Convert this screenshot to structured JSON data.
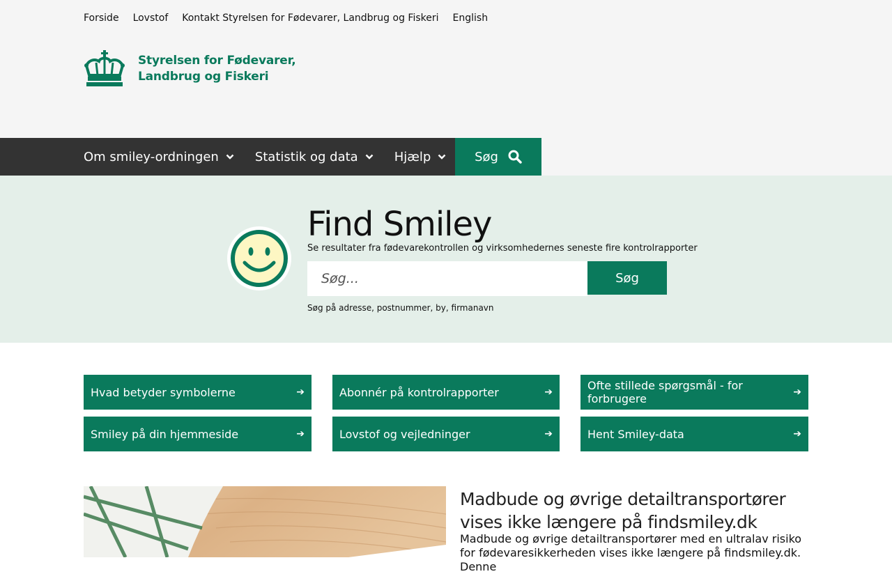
{
  "topnav": [
    "Forside",
    "Lovstof",
    "Kontakt Styrelsen for Fødevarer, Landbrug og Fiskeri",
    "English"
  ],
  "logo": {
    "line1": "Styrelsen for Fødevarer,",
    "line2": "Landbrug og Fiskeri"
  },
  "mainnav": {
    "items": [
      "Om smiley-ordningen",
      "Statistik og data",
      "Hjælp"
    ],
    "search_label": "Søg"
  },
  "hero": {
    "title": "Find Smiley",
    "subtitle": "Se resultater fra fødevarekontrollen og virksomhedernes seneste fire kontrolrapporter",
    "search_placeholder": "Søg...",
    "search_button": "Søg",
    "hint": "Søg på adresse, postnummer, by, firmanavn"
  },
  "quicklinks": [
    "Hvad betyder symbolerne",
    "Abonnér på kontrolrapporter",
    "Ofte stillede spørgsmål - for forbrugere",
    "Smiley på din hjemmeside",
    "Lovstof og vejledninger",
    "Hent Smiley-data"
  ],
  "news": {
    "title": "Madbude og øvrige detailtransportører vises ikke længere på findsmiley.dk",
    "text": "Madbude og øvrige detailtransportører med en ultralav risiko for fødevaresikkerheden vises ikke længere på findsmiley.dk. Denne"
  },
  "colors": {
    "brand_green": "#0a7a5c",
    "nav_dark": "#333333",
    "hero_bg": "#e4efe9",
    "header_bg": "#f5f5f5"
  }
}
